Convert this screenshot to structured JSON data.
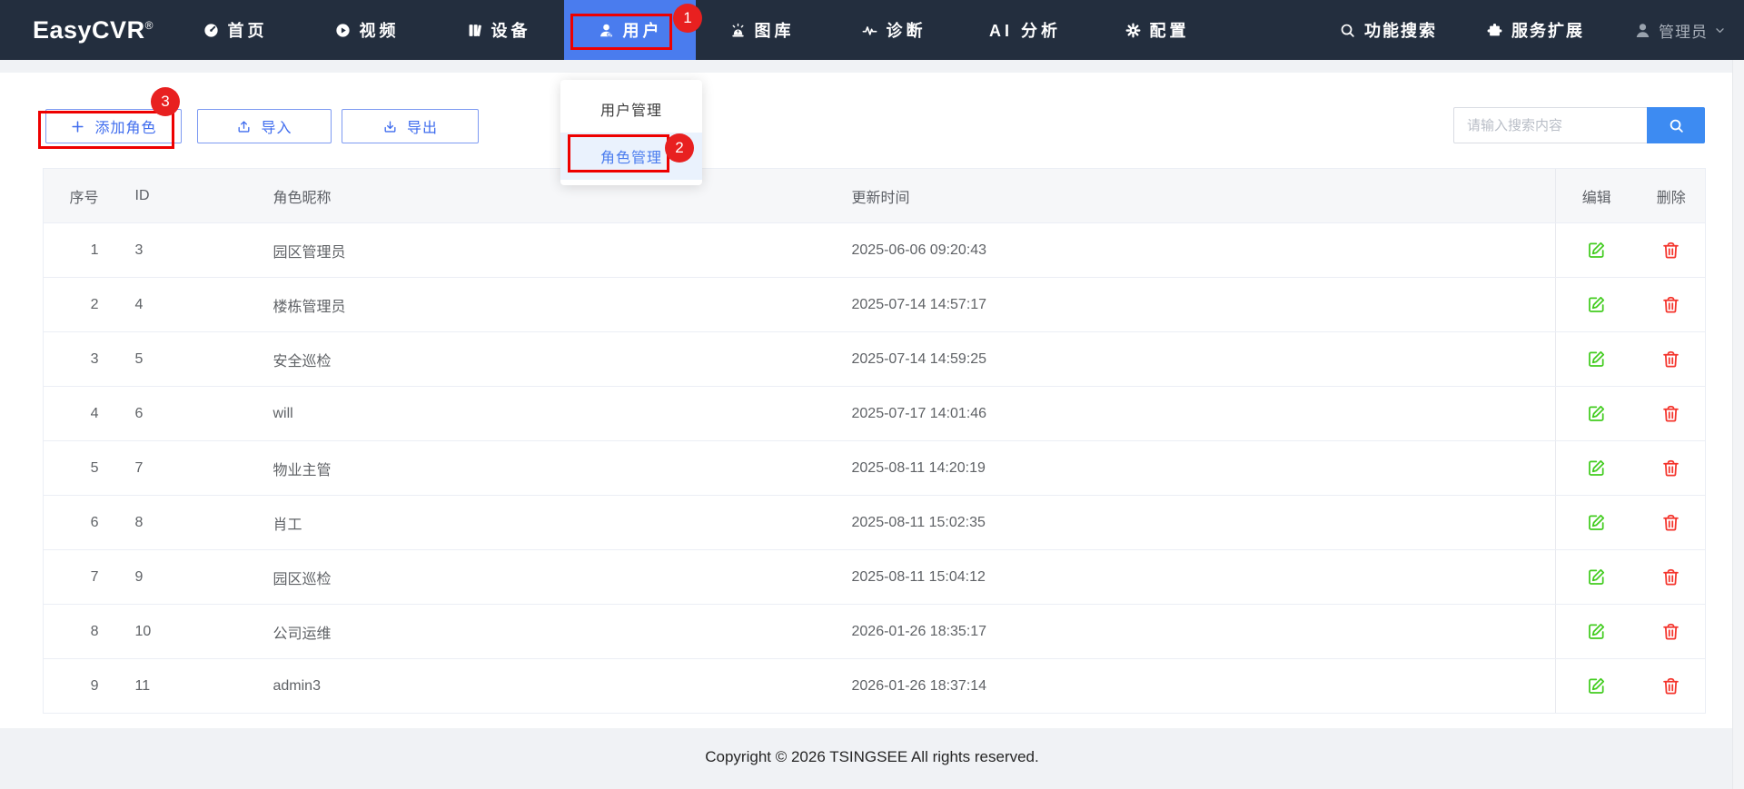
{
  "navbar": {
    "logo": "EasyCVR",
    "logo_mark": "®",
    "items": [
      {
        "label": "首页",
        "icon": "dashboard-icon",
        "active": false
      },
      {
        "label": "视频",
        "icon": "play-icon",
        "active": false
      },
      {
        "label": "设备",
        "icon": "device-icon",
        "active": false
      },
      {
        "label": "用户",
        "icon": "user-icon",
        "active": true
      },
      {
        "label": "图库",
        "icon": "alarm-light-icon",
        "active": false
      },
      {
        "label": "诊断",
        "icon": "pulse-icon",
        "active": false
      },
      {
        "label": "AI 分析",
        "icon": null,
        "active": false
      },
      {
        "label": "配置",
        "icon": "gear-icon",
        "active": false
      }
    ],
    "feature_search_label": "功能搜索",
    "service_extension_label": "服务扩展",
    "user_label": "管理员"
  },
  "dropdown": {
    "items": [
      {
        "label": "用户管理",
        "active": false
      },
      {
        "label": "角色管理",
        "active": true
      }
    ]
  },
  "toolbar": {
    "add_role_label": "添加角色",
    "import_label": "导入",
    "export_label": "导出",
    "search_placeholder": "请输入搜索内容",
    "search_value": ""
  },
  "annotations": {
    "step1": "1",
    "step2": "2",
    "step3": "3"
  },
  "table": {
    "headers": {
      "index": "序号",
      "id": "ID",
      "name": "角色昵称",
      "updated": "更新时间",
      "edit": "编辑",
      "delete": "删除"
    },
    "rows": [
      {
        "index": "1",
        "id": "3",
        "name": "园区管理员",
        "updated": "2025-06-06 09:20:43"
      },
      {
        "index": "2",
        "id": "4",
        "name": "楼栋管理员",
        "updated": "2025-07-14 14:57:17"
      },
      {
        "index": "3",
        "id": "5",
        "name": "安全巡检",
        "updated": "2025-07-14 14:59:25"
      },
      {
        "index": "4",
        "id": "6",
        "name": "will",
        "updated": "2025-07-17 14:01:46"
      },
      {
        "index": "5",
        "id": "7",
        "name": "物业主管",
        "updated": "2025-08-11 14:20:19"
      },
      {
        "index": "6",
        "id": "8",
        "name": "肖工",
        "updated": "2025-08-11 15:02:35"
      },
      {
        "index": "7",
        "id": "9",
        "name": "园区巡检",
        "updated": "2025-08-11 15:04:12"
      },
      {
        "index": "8",
        "id": "10",
        "name": "公司运维",
        "updated": "2026-01-26 18:35:17"
      },
      {
        "index": "9",
        "id": "11",
        "name": "admin3",
        "updated": "2026-01-26 18:37:14"
      }
    ]
  },
  "footer": {
    "copyright": "Copyright © 2026 TSINGSEE All rights reserved."
  },
  "colors": {
    "navbar_bg": "#232e3e",
    "nav_active_bg": "#4a7cee",
    "primary_button_blue": "#3f6cee",
    "search_button_blue": "#3d8bf2",
    "annotation_red": "#ee0000",
    "badge_red": "#e82020",
    "edit_icon_green": "#42cc1f",
    "delete_icon_red": "#f4342c",
    "table_header_bg": "#f6f7f9",
    "page_gray": "#f0f2f5"
  }
}
